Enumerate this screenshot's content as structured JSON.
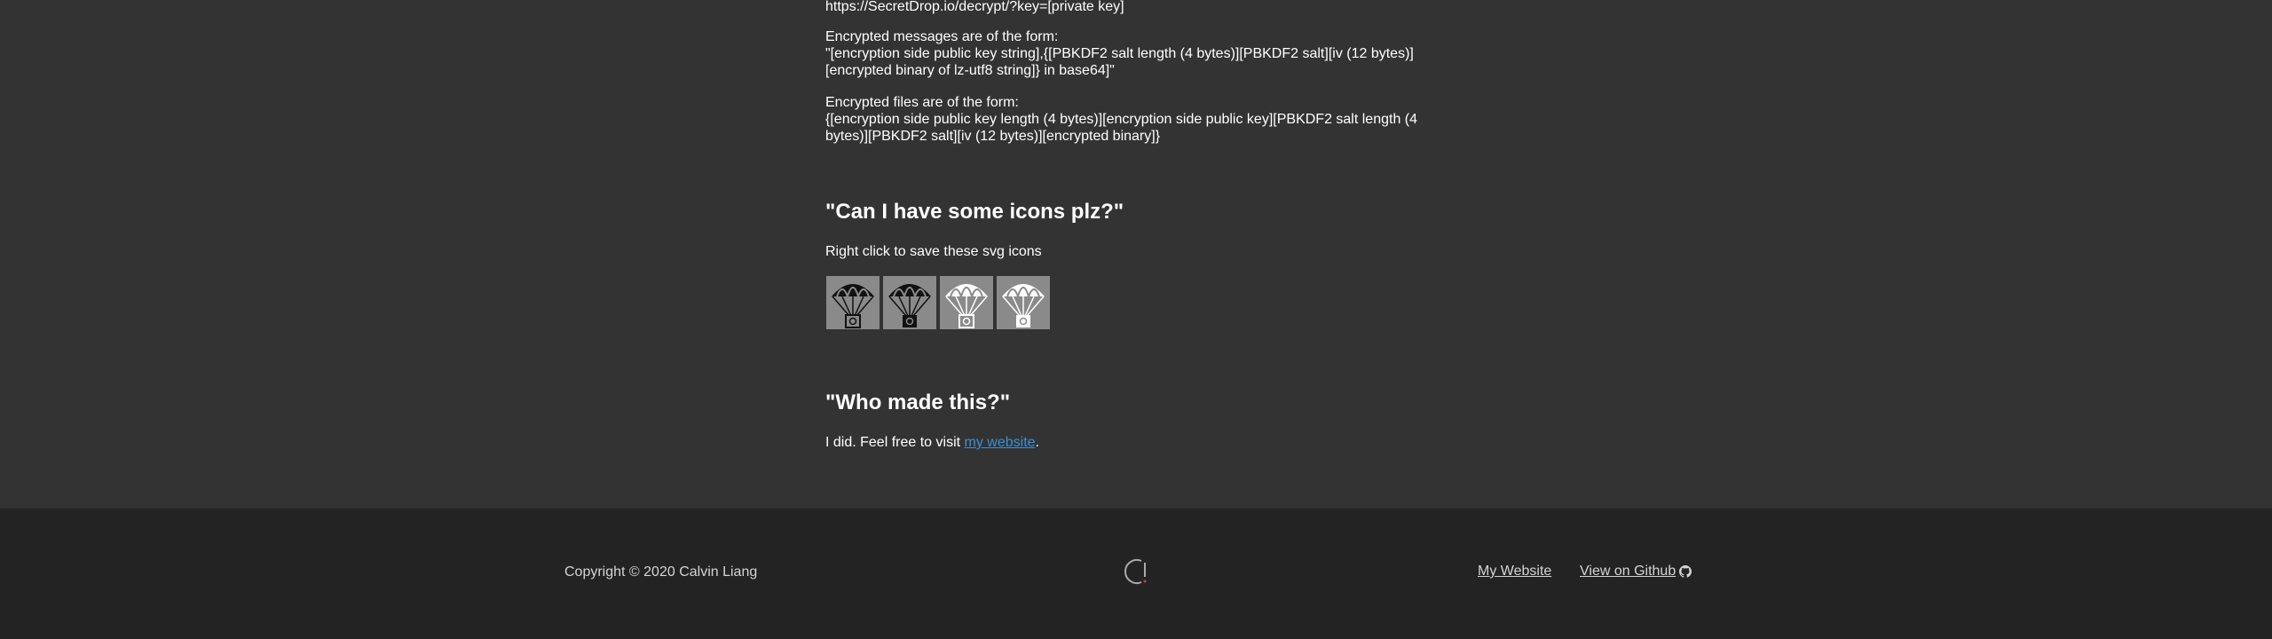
{
  "faq": {
    "decrypt_url": "https://SecretDrop.io/decrypt/?key=[private key]",
    "messages_intro": "Encrypted messages are of the form:",
    "messages_format": "\"[encryption side public key string],{[PBKDF2 salt length (4 bytes)][PBKDF2 salt][iv (12 bytes)][encrypted binary of lz-utf8 string]} in base64]\"",
    "files_intro": "Encrypted files are of the form:",
    "files_format": "{[encryption side public key length (4 bytes)][encryption side public key][PBKDF2 salt length (4 bytes)][PBKDF2 salt][iv (12 bytes)][encrypted binary]}",
    "icons_heading": "\"Can I have some icons plz?\"",
    "icons_description": "Right click to save these svg icons",
    "icons": [
      {
        "name": "parachute-icon-black-outline"
      },
      {
        "name": "parachute-icon-black-solid"
      },
      {
        "name": "parachute-icon-white-outline"
      },
      {
        "name": "parachute-icon-white-solid"
      }
    ],
    "who_heading": "\"Who made this?\"",
    "who_text_before": "I did. Feel free to visit ",
    "who_link": "my website",
    "who_text_after": "."
  },
  "footer": {
    "copyright": "Copyright © 2020 Calvin Liang",
    "logo_icon": "c-bang-logo-icon",
    "my_website": "My Website",
    "github": "View on Github",
    "github_icon": "github-icon"
  },
  "colors": {
    "background": "#333333",
    "footer_background": "#232323",
    "link": "#3d8fd4",
    "icon_tile": "#8a8a8a"
  }
}
